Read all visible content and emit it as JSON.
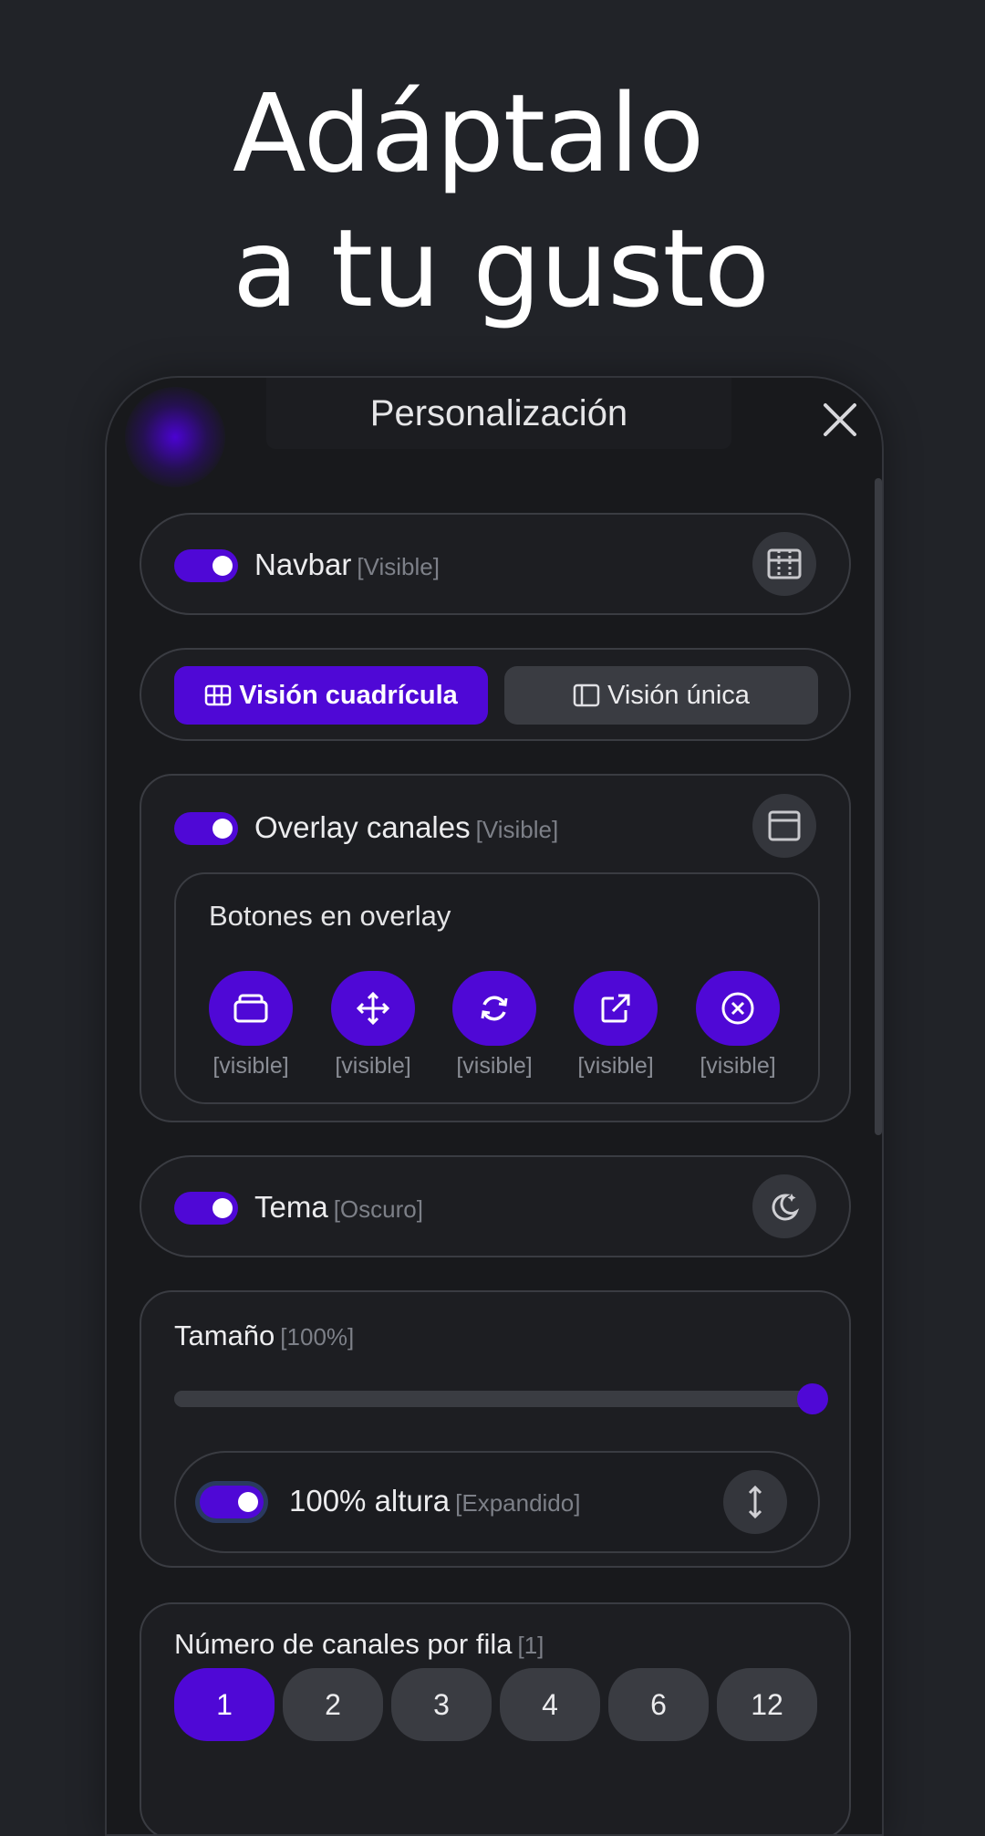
{
  "headline": {
    "line1": "Adáptalo",
    "line2": "a tu gusto"
  },
  "panel": {
    "title": "Personalización",
    "close_icon": "close-icon"
  },
  "navbar": {
    "label": "Navbar",
    "status": "[Visible]",
    "enabled": true,
    "icon": "navbar-layout-icon"
  },
  "view_mode": {
    "grid": {
      "label": "Visión cuadrícula",
      "icon": "grid-icon",
      "active": true
    },
    "single": {
      "label": "Visión única",
      "icon": "sidebar-layout-icon",
      "active": false
    }
  },
  "overlay": {
    "label": "Overlay canales",
    "status": "[Visible]",
    "enabled": true,
    "icon": "window-icon",
    "buttons_title": "Botones en overlay",
    "buttons": [
      {
        "icon": "folder-icon",
        "status": "[visible]"
      },
      {
        "icon": "move-icon",
        "status": "[visible]"
      },
      {
        "icon": "refresh-icon",
        "status": "[visible]"
      },
      {
        "icon": "external-link-icon",
        "status": "[visible]"
      },
      {
        "icon": "close-circle-icon",
        "status": "[visible]"
      }
    ]
  },
  "theme": {
    "label": "Tema",
    "status": "[Oscuro]",
    "enabled": true,
    "icon": "moon-stars-icon"
  },
  "size": {
    "label": "Tamaño",
    "status": "[100%]",
    "value_percent": 100,
    "height": {
      "label": "100% altura",
      "status": "[Expandido]",
      "enabled": true,
      "icon": "vertical-resize-icon"
    }
  },
  "channels_per_row": {
    "label": "Número de canales por fila",
    "status": "[1]",
    "options": [
      "1",
      "2",
      "3",
      "4",
      "6",
      "12"
    ],
    "selected": "1"
  },
  "colors": {
    "accent": "#4f08d6",
    "background": "#212328",
    "panel": "#18191c"
  }
}
